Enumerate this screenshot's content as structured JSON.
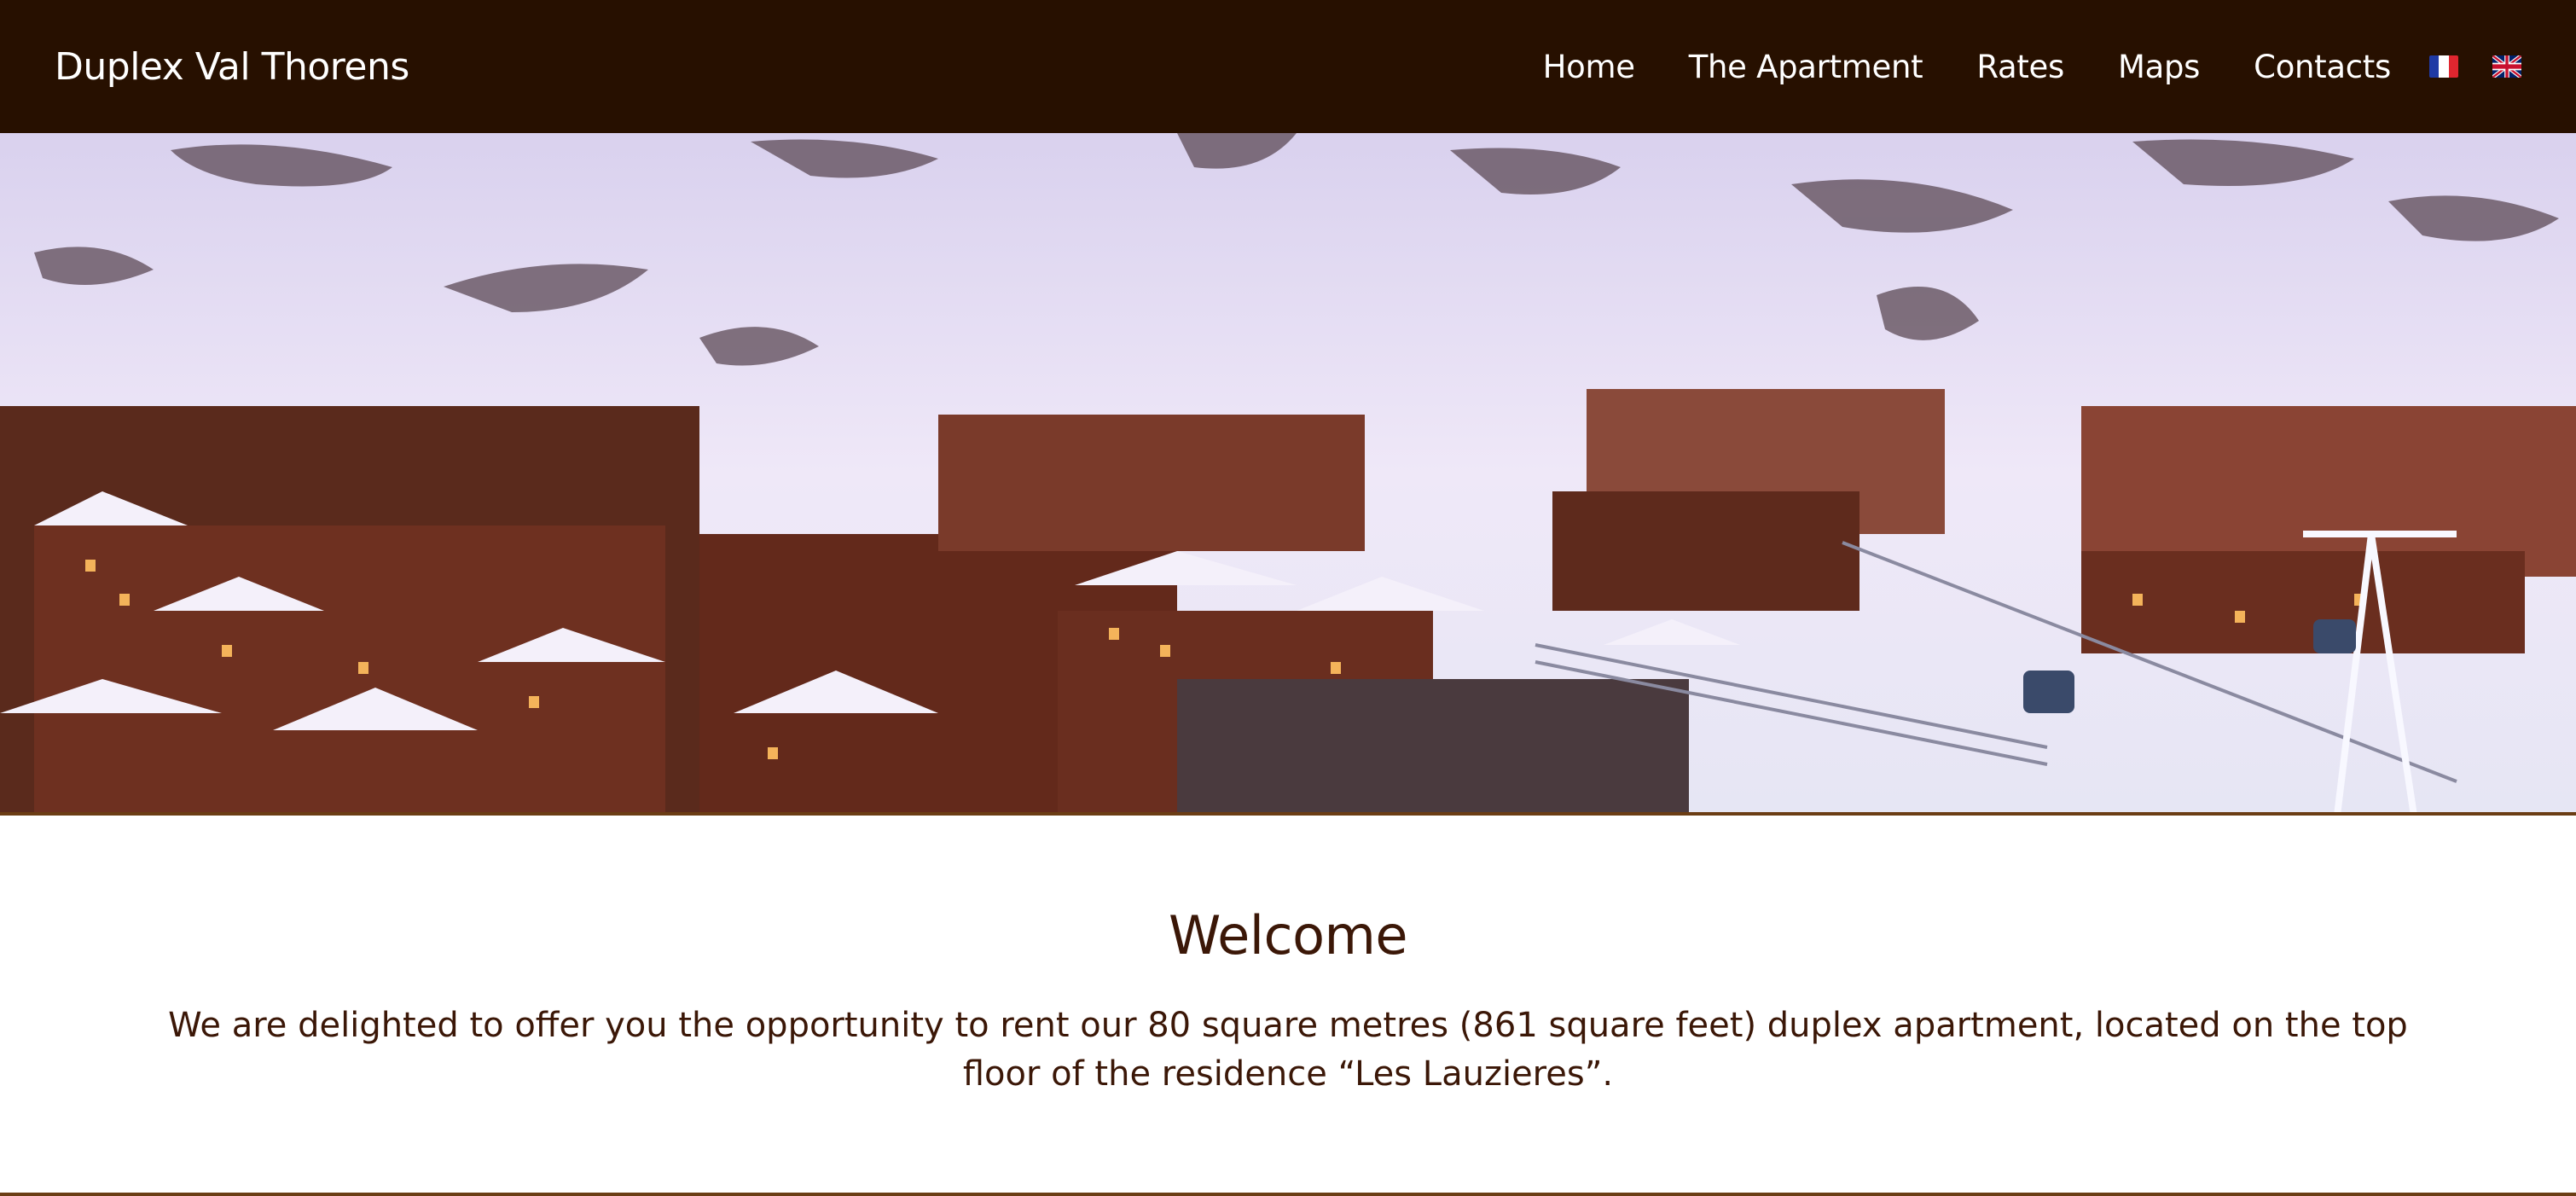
{
  "header": {
    "brand": "Duplex Val Thorens",
    "nav": [
      {
        "label": "Home"
      },
      {
        "label": "The Apartment"
      },
      {
        "label": "Rates"
      },
      {
        "label": "Maps"
      },
      {
        "label": "Contacts"
      }
    ],
    "languages": [
      {
        "icon": "french-flag-icon"
      },
      {
        "icon": "uk-flag-icon"
      }
    ]
  },
  "hero": {
    "image": "val-thorens-ski-resort-photo"
  },
  "welcome": {
    "title": "Welcome",
    "text": "We are delighted to offer you the opportunity to rent our 80 square metres (861 square feet) duplex apartment, located on the top floor of the residence “Les Lauzieres”."
  },
  "colors": {
    "header_bg": "#271000",
    "text": "#3b1707",
    "accent_line": "#6b3d14"
  }
}
